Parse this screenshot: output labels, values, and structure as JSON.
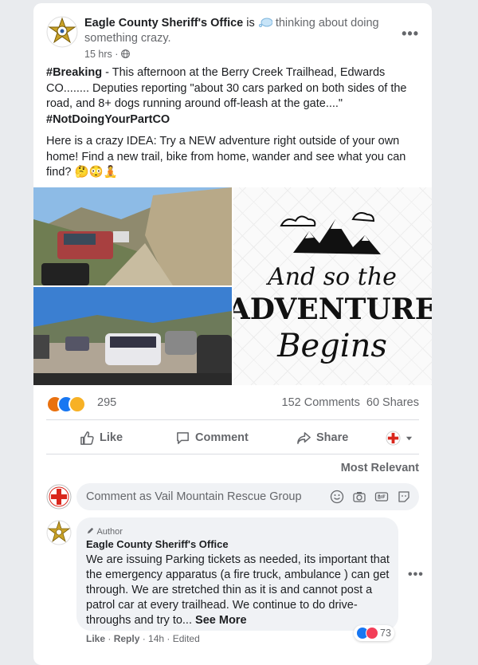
{
  "post": {
    "page_name": "Eagle County Sheriff's Office",
    "activity_prefix": "is",
    "activity": "thinking about doing something crazy.",
    "time": "15 hrs",
    "para1_tag": "#Breaking",
    "para1_text": " - This afternoon at the Berry Creek Trailhead, Edwards CO........ Deputies reporting \"about 30 cars parked on both sides of the road, and 8+ dogs running around off-leash at the gate....\"",
    "para1_hashtag": "#NotDoingYourPartCO",
    "para2_text": "Here is a crazy IDEA: Try a NEW adventure right outside of your own home! Find a new trail, bike from home, wander and see what you can find? 🤔😳🧘",
    "image_text": [
      "And so the",
      "ADVENTURE",
      "Begins"
    ]
  },
  "stats": {
    "reaction_count": "295",
    "comments": "152 Comments",
    "shares": "60 Shares"
  },
  "actions": {
    "like": "Like",
    "comment": "Comment",
    "share": "Share"
  },
  "comments": {
    "sort": "Most Relevant",
    "placeholder": "Comment as Vail Mountain Rescue Group",
    "first": {
      "badge": "Author",
      "name": "Eagle County Sheriff's Office",
      "text": "We are issuing Parking tickets as needed, its important that the emergency apparatus (a fire truck, ambulance ) can get through. We are stretched thin as it is and cannot post a patrol car at every trailhead. We continue to do drive-throughs and try to...",
      "see_more": "See More",
      "reaction_count": "73",
      "like": "Like",
      "reply": "Reply",
      "time": "14h",
      "edited": "Edited"
    }
  },
  "colors": {
    "facebook_blue": "#1877f2",
    "text": "#1c1e21",
    "secondary": "#65676b",
    "angry": "#e9710f",
    "love": "#f33e58",
    "wow": "#f7b125"
  }
}
